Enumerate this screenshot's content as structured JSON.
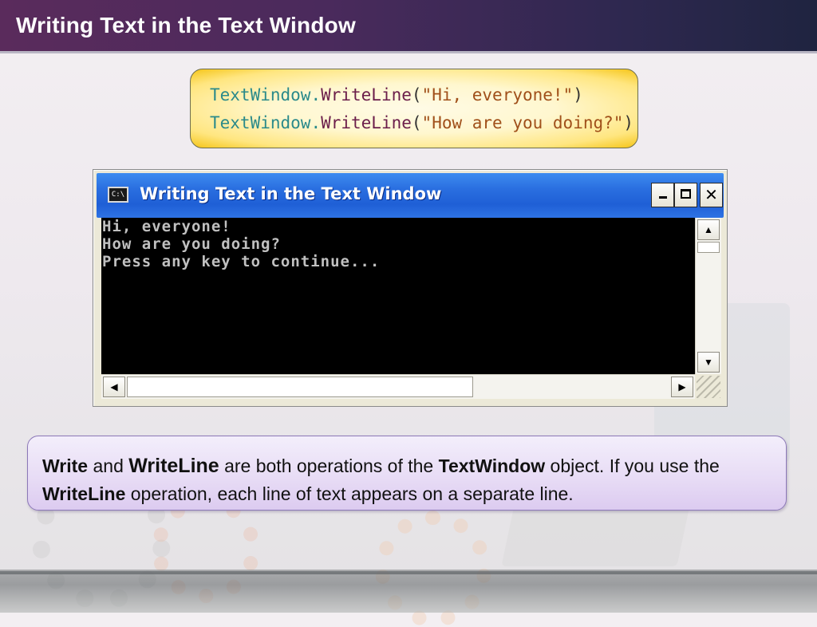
{
  "slide": {
    "title": "Writing Text in the Text Window"
  },
  "code": {
    "lines": [
      {
        "object": "TextWindow",
        "dot": ".",
        "method": "WriteLine",
        "open": "(",
        "string": "\"Hi, everyone!\"",
        "close": ")"
      },
      {
        "object": "TextWindow",
        "dot": ".",
        "method": "WriteLine",
        "open": "(",
        "string": "\"How are you doing?\"",
        "close": ")"
      }
    ]
  },
  "console_window": {
    "icon_label": "C:\\",
    "title": "Writing Text in the Text Window",
    "buttons": {
      "minimize": "minimize",
      "maximize": "maximize",
      "close": "✕"
    },
    "output_lines": [
      "Hi, everyone!",
      "How are you doing?",
      "Press any key to continue..."
    ],
    "scroll_up": "▲",
    "scroll_down": "▼",
    "scroll_left": "◀",
    "scroll_right": "▶"
  },
  "info": {
    "term_write": "Write",
    "and": " and ",
    "term_writeline": "WriteLine",
    "text1": " are both operations of the ",
    "term_textwindow": "TextWindow",
    "text2": " object. If you use the ",
    "term_writeline2": "WriteLine",
    "text3": " operation, each line of text appears on a separate line."
  },
  "colors": {
    "title_bar": "#4a2a5c",
    "code_box_fill": "#ffe680",
    "console_titlebar": "#2a6fe0",
    "info_box_fill": "#e7dbf5"
  }
}
